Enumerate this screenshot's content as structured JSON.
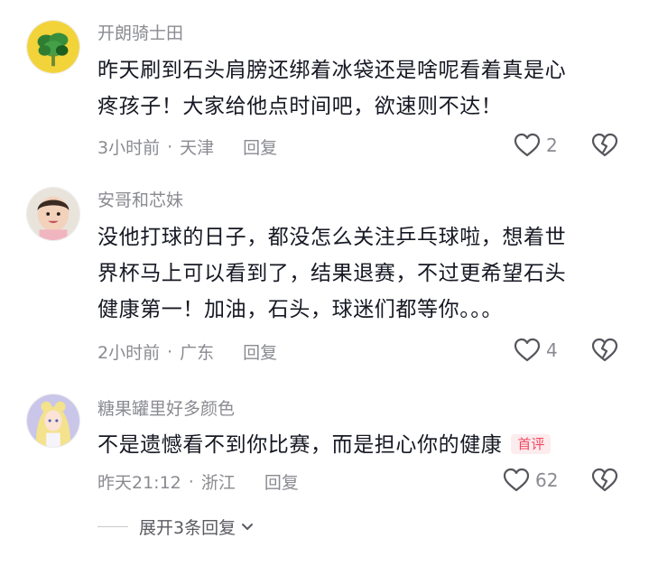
{
  "comments": [
    {
      "username": "开朗骑士田",
      "text_lines": [
        "昨天刷到石头肩膀还绑着冰袋还是啥呢看着真是心",
        "疼孩子！大家给他点时间吧，欲速则不达！"
      ],
      "time": "3小时前",
      "location": "天津",
      "reply_label": "回复",
      "likes": "2",
      "badge": ""
    },
    {
      "username": "安哥和芯妹",
      "text_lines": [
        "没他打球的日子，都没怎么关注乒乓球啦，想着世",
        "界杯马上可以看到了，结果退赛，不过更希望石头",
        "健康第一！加油，石头，球迷们都等你。。。"
      ],
      "time": "2小时前",
      "location": "广东",
      "reply_label": "回复",
      "likes": "4",
      "badge": ""
    },
    {
      "username": "糖果罐里好多颜色",
      "text_lines": [
        "不是遗憾看不到你比赛，而是担心你的健康"
      ],
      "time": "昨天21:12",
      "location": "浙江",
      "reply_label": "回复",
      "likes": "62",
      "badge": "首评"
    }
  ],
  "expand_label": "展开3条回复",
  "icons": {
    "like": "heart-outline-icon",
    "dislike": "broken-heart-icon",
    "expand": "chevron-down-icon"
  },
  "colors": {
    "meta": "#8a8b91",
    "badge_text": "#f24961",
    "badge_bg": "#fdecee"
  }
}
